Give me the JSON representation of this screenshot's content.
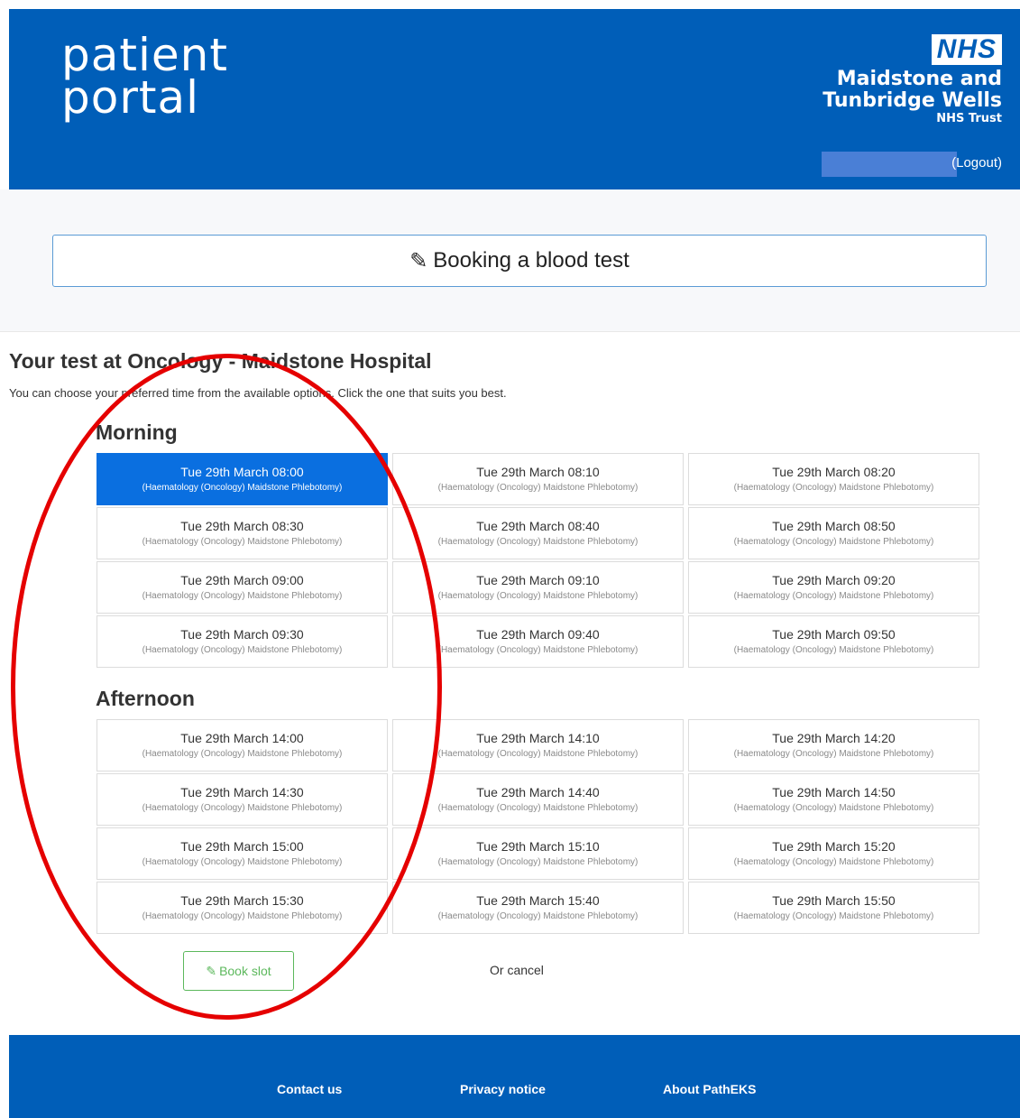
{
  "header": {
    "logo_line1": "patient",
    "logo_line2": "portal",
    "nhs_badge": "NHS",
    "trust_name_line1": "Maidstone and",
    "trust_name_line2": "Tunbridge Wells",
    "trust_sub": "NHS Trust",
    "logout": "(Logout)"
  },
  "banner": {
    "title": "Booking a blood test",
    "icon": "pencil-icon"
  },
  "content": {
    "test_title": "Your test at Oncology - Maidstone Hospital",
    "instruction": "You can choose your preferred time from the available options. Click the one that suits you best.",
    "morning_label": "Morning",
    "afternoon_label": "Afternoon",
    "morning_slots": [
      {
        "time": "Tue 29th March 08:00",
        "location": "(Haematology (Oncology) Maidstone Phlebotomy)",
        "selected": true
      },
      {
        "time": "Tue 29th March 08:10",
        "location": "(Haematology (Oncology) Maidstone Phlebotomy)",
        "selected": false
      },
      {
        "time": "Tue 29th March 08:20",
        "location": "(Haematology (Oncology) Maidstone Phlebotomy)",
        "selected": false
      },
      {
        "time": "Tue 29th March 08:30",
        "location": "(Haematology (Oncology) Maidstone Phlebotomy)",
        "selected": false
      },
      {
        "time": "Tue 29th March 08:40",
        "location": "(Haematology (Oncology) Maidstone Phlebotomy)",
        "selected": false
      },
      {
        "time": "Tue 29th March 08:50",
        "location": "(Haematology (Oncology) Maidstone Phlebotomy)",
        "selected": false
      },
      {
        "time": "Tue 29th March 09:00",
        "location": "(Haematology (Oncology) Maidstone Phlebotomy)",
        "selected": false
      },
      {
        "time": "Tue 29th March 09:10",
        "location": "(Haematology (Oncology) Maidstone Phlebotomy)",
        "selected": false
      },
      {
        "time": "Tue 29th March 09:20",
        "location": "(Haematology (Oncology) Maidstone Phlebotomy)",
        "selected": false
      },
      {
        "time": "Tue 29th March 09:30",
        "location": "(Haematology (Oncology) Maidstone Phlebotomy)",
        "selected": false
      },
      {
        "time": "Tue 29th March 09:40",
        "location": "(Haematology (Oncology) Maidstone Phlebotomy)",
        "selected": false
      },
      {
        "time": "Tue 29th March 09:50",
        "location": "(Haematology (Oncology) Maidstone Phlebotomy)",
        "selected": false
      }
    ],
    "afternoon_slots": [
      {
        "time": "Tue 29th March 14:00",
        "location": "(Haematology (Oncology) Maidstone Phlebotomy)",
        "selected": false
      },
      {
        "time": "Tue 29th March 14:10",
        "location": "(Haematology (Oncology) Maidstone Phlebotomy)",
        "selected": false
      },
      {
        "time": "Tue 29th March 14:20",
        "location": "(Haematology (Oncology) Maidstone Phlebotomy)",
        "selected": false
      },
      {
        "time": "Tue 29th March 14:30",
        "location": "(Haematology (Oncology) Maidstone Phlebotomy)",
        "selected": false
      },
      {
        "time": "Tue 29th March 14:40",
        "location": "(Haematology (Oncology) Maidstone Phlebotomy)",
        "selected": false
      },
      {
        "time": "Tue 29th March 14:50",
        "location": "(Haematology (Oncology) Maidstone Phlebotomy)",
        "selected": false
      },
      {
        "time": "Tue 29th March 15:00",
        "location": "(Haematology (Oncology) Maidstone Phlebotomy)",
        "selected": false
      },
      {
        "time": "Tue 29th March 15:10",
        "location": "(Haematology (Oncology) Maidstone Phlebotomy)",
        "selected": false
      },
      {
        "time": "Tue 29th March 15:20",
        "location": "(Haematology (Oncology) Maidstone Phlebotomy)",
        "selected": false
      },
      {
        "time": "Tue 29th March 15:30",
        "location": "(Haematology (Oncology) Maidstone Phlebotomy)",
        "selected": false
      },
      {
        "time": "Tue 29th March 15:40",
        "location": "(Haematology (Oncology) Maidstone Phlebotomy)",
        "selected": false
      },
      {
        "time": "Tue 29th March 15:50",
        "location": "(Haematology (Oncology) Maidstone Phlebotomy)",
        "selected": false
      }
    ],
    "book_button": "Book slot",
    "cancel_link": "Or cancel"
  },
  "footer": {
    "links": [
      "Contact us",
      "Privacy notice",
      "About PathEKS"
    ]
  },
  "colors": {
    "brand_blue": "#005eb8",
    "selected_slot": "#0a6fe0",
    "book_green": "#5cb85c",
    "highlight_red": "#e50000"
  }
}
